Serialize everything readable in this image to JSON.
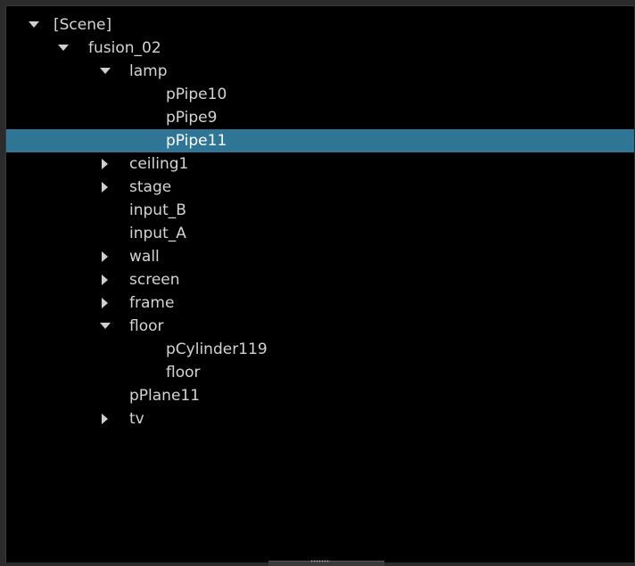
{
  "outliner": {
    "selected_color": "#2f7696",
    "items": [
      {
        "label": "[Scene]",
        "depth": 0,
        "state": "expanded",
        "selected": false
      },
      {
        "label": "fusion_02",
        "depth": 1,
        "state": "expanded",
        "selected": false
      },
      {
        "label": "lamp",
        "depth": 2,
        "state": "expanded",
        "selected": false
      },
      {
        "label": "pPipe10",
        "depth": 3,
        "state": "leaf",
        "selected": false
      },
      {
        "label": "pPipe9",
        "depth": 3,
        "state": "leaf",
        "selected": false
      },
      {
        "label": "pPipe11",
        "depth": 3,
        "state": "leaf",
        "selected": true
      },
      {
        "label": "ceiling1",
        "depth": 2,
        "state": "collapsed",
        "selected": false
      },
      {
        "label": "stage",
        "depth": 2,
        "state": "collapsed",
        "selected": false
      },
      {
        "label": "input_B",
        "depth": 2,
        "state": "leaf",
        "selected": false
      },
      {
        "label": "input_A",
        "depth": 2,
        "state": "leaf",
        "selected": false
      },
      {
        "label": "wall",
        "depth": 2,
        "state": "collapsed",
        "selected": false
      },
      {
        "label": "screen",
        "depth": 2,
        "state": "collapsed",
        "selected": false
      },
      {
        "label": "frame",
        "depth": 2,
        "state": "collapsed",
        "selected": false
      },
      {
        "label": "floor",
        "depth": 2,
        "state": "expanded",
        "selected": false
      },
      {
        "label": "pCylinder119",
        "depth": 3,
        "state": "leaf",
        "selected": false
      },
      {
        "label": "floor",
        "depth": 3,
        "state": "leaf",
        "selected": false
      },
      {
        "label": "pPlane11",
        "depth": 2,
        "state": "leaf",
        "selected": false
      },
      {
        "label": "tv",
        "depth": 2,
        "state": "collapsed",
        "selected": false
      }
    ]
  }
}
